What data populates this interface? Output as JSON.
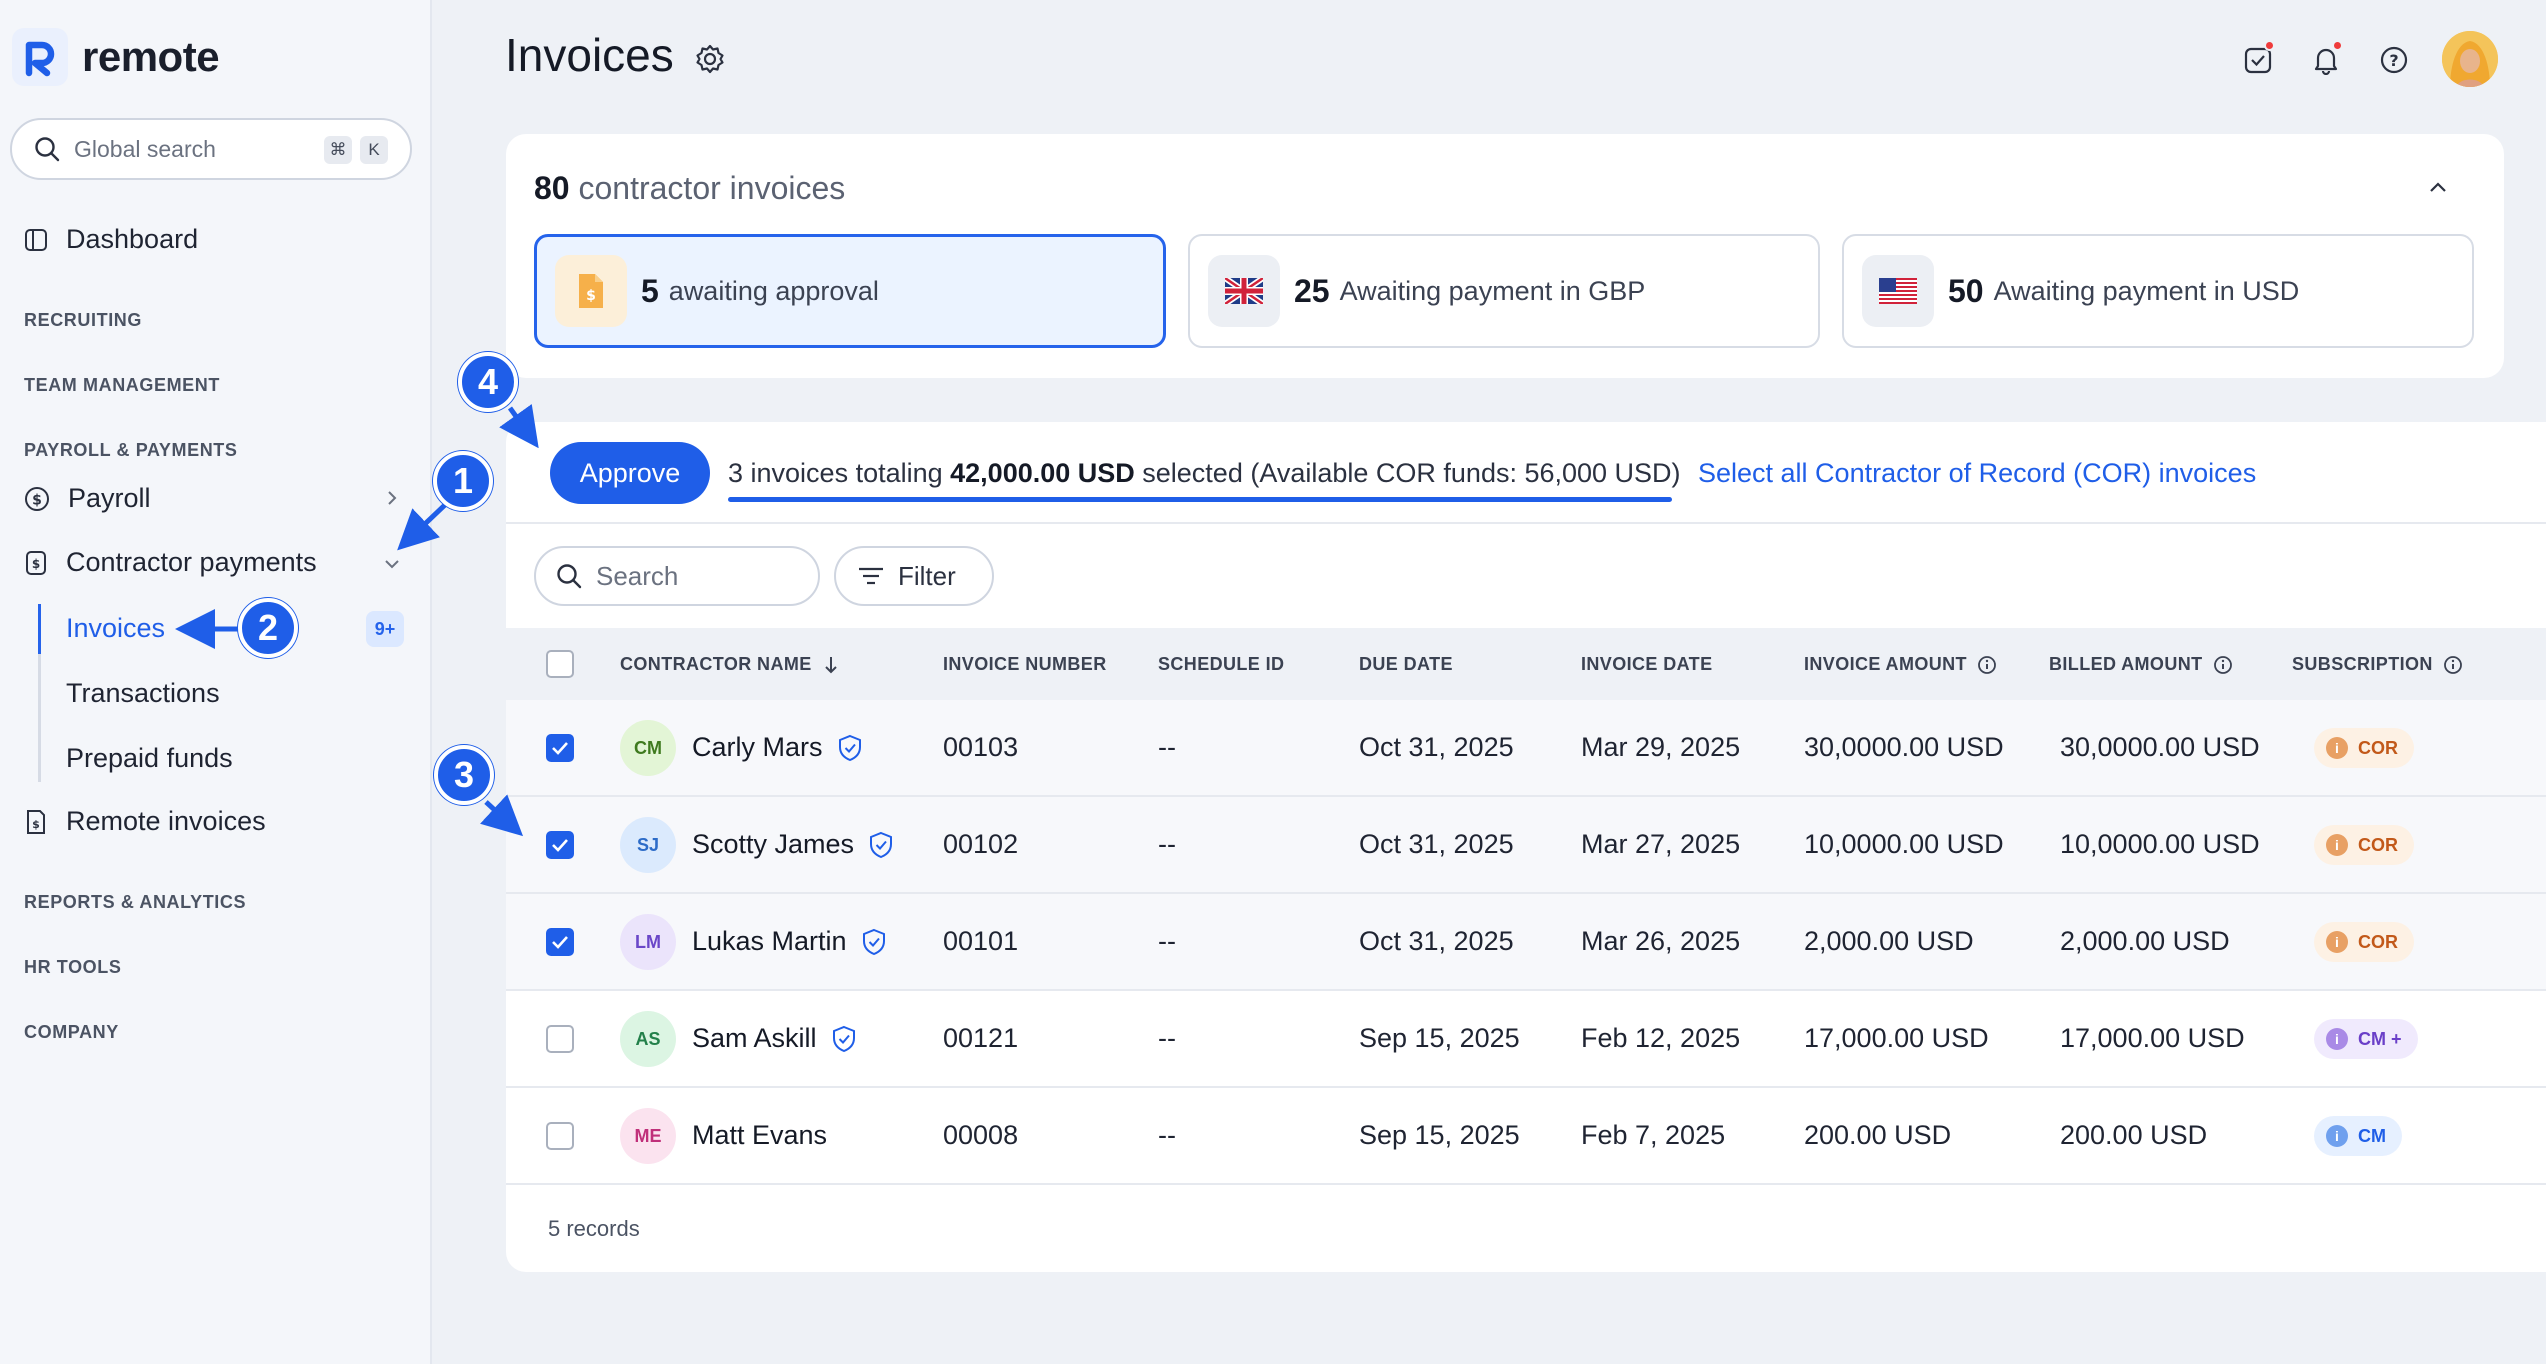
{
  "app": {
    "logo_text": "remote"
  },
  "sidebar": {
    "search": {
      "placeholder": "Global search",
      "shortcut_mod": "⌘",
      "shortcut_key": "K"
    },
    "dashboard": "Dashboard",
    "sections": {
      "recruiting": "RECRUITING",
      "team": "TEAM MANAGEMENT",
      "payroll": "PAYROLL & PAYMENTS",
      "reports": "REPORTS & ANALYTICS",
      "hr": "HR TOOLS",
      "company": "COMPANY"
    },
    "payroll": "Payroll",
    "contractor_payments": "Contractor payments",
    "subitems": {
      "invoices": "Invoices",
      "invoices_badge": "9+",
      "transactions": "Transactions",
      "prepaid": "Prepaid funds"
    },
    "remote_invoices": "Remote invoices"
  },
  "header": {
    "title": "Invoices"
  },
  "summary": {
    "count": "80",
    "label": "contractor invoices",
    "stats": [
      {
        "value": "5",
        "label": "awaiting approval"
      },
      {
        "value": "25",
        "label": "Awaiting payment in GBP"
      },
      {
        "value": "50",
        "label": "Awaiting payment in USD"
      }
    ]
  },
  "actions": {
    "approve": "Approve",
    "selected_prefix": "3 invoices totaling ",
    "selected_amount": "42,000.00 USD",
    "selected_suffix": " selected (Available COR funds: 56,000 USD)",
    "select_all": "Select all Contractor of Record (COR) invoices"
  },
  "table": {
    "search_placeholder": "Search",
    "filter": "Filter",
    "columns": {
      "name": "CONTRACTOR NAME",
      "number": "INVOICE NUMBER",
      "schedule": "SCHEDULE ID",
      "due": "DUE DATE",
      "inv_date": "INVOICE DATE",
      "inv_amount": "INVOICE AMOUNT",
      "billed": "BILLED AMOUNT",
      "subscription": "SUBSCRIPTION"
    },
    "rows": [
      {
        "initials": "CM",
        "name": "Carly Mars",
        "number": "00103",
        "schedule": "--",
        "due": "Oct 31, 2025",
        "inv_date": "Mar 29, 2025",
        "amount": "30,0000.00 USD",
        "billed": "30,0000.00 USD",
        "sub": "COR"
      },
      {
        "initials": "SJ",
        "name": "Scotty James",
        "number": "00102",
        "schedule": "--",
        "due": "Oct 31, 2025",
        "inv_date": "Mar 27, 2025",
        "amount": "10,0000.00 USD",
        "billed": "10,0000.00 USD",
        "sub": "COR"
      },
      {
        "initials": "LM",
        "name": "Lukas Martin",
        "number": "00101",
        "schedule": "--",
        "due": "Oct 31, 2025",
        "inv_date": "Mar 26, 2025",
        "amount": "2,000.00 USD",
        "billed": "2,000.00 USD",
        "sub": "COR"
      },
      {
        "initials": "AS",
        "name": "Sam Askill",
        "number": "00121",
        "schedule": "--",
        "due": "Sep 15, 2025",
        "inv_date": "Feb 12, 2025",
        "amount": "17,000.00 USD",
        "billed": "17,000.00 USD",
        "sub": "CM +"
      },
      {
        "initials": "ME",
        "name": "Matt Evans",
        "number": "00008",
        "schedule": "--",
        "due": "Sep 15, 2025",
        "inv_date": "Feb 7, 2025",
        "amount": "200.00 USD",
        "billed": "200.00 USD",
        "sub": "CM"
      }
    ],
    "records": "5 records"
  },
  "callouts": [
    "1",
    "2",
    "3",
    "4"
  ],
  "colors": {
    "accent": "#1f5ee8",
    "cor_badge": "#fdf1e4",
    "cm_badge": "#e6f0ff",
    "cmplus_badge": "#f0eafd"
  }
}
